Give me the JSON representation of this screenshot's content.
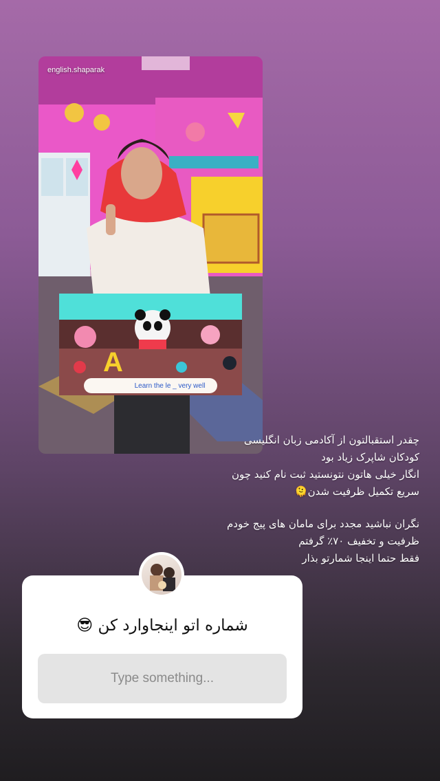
{
  "media": {
    "source_handle": "english.shaparak",
    "subtitle_text": "Learn the le _ very well"
  },
  "caption": {
    "lines_part1": [
      "چقدر استقبالتون از آکادمی زبان انگلیسی",
      "کودکان شاپرک زیاد بود",
      "انگار خیلی هاتون نتونستید ثبت نام کنید چون",
      "سریع تکمیل ظرفیت شدن🫠"
    ],
    "lines_part2": [
      "نگران نباشید مجدد برای مامان های پیج خودم",
      "ظرفیت و تخفیف ۷۰٪ گرفتم",
      "فقط حتما اینجا شمارتو بذار"
    ]
  },
  "question_sticker": {
    "prompt": "شماره اتو اینجاوارد کن 😎",
    "placeholder": "Type something..."
  },
  "colors": {
    "card_bg": "#ffffff",
    "input_bg": "#e4e4e4",
    "placeholder": "#8a8a8a"
  }
}
